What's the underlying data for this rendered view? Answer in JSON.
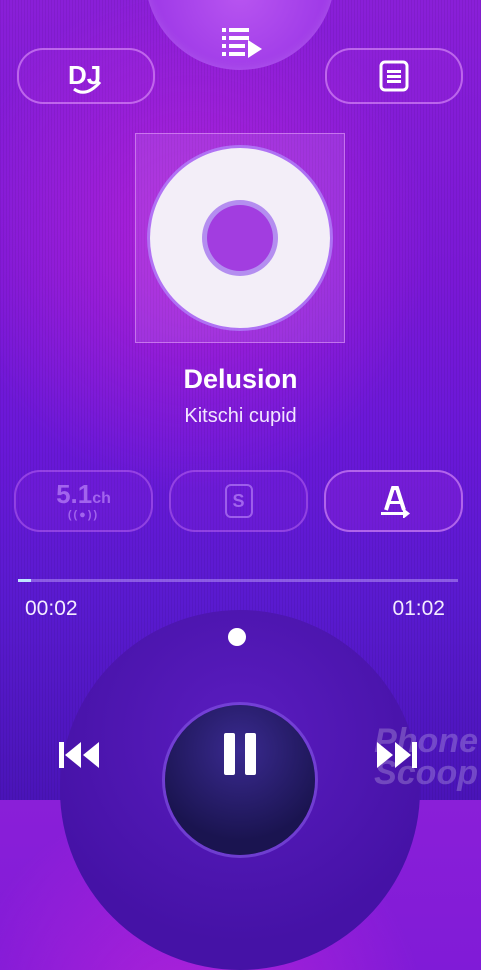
{
  "track": {
    "title": "Delusion",
    "artist": "Kitschi cupid"
  },
  "top": {
    "playlist_icon": "playlist-icon",
    "dj_icon": "dj-icon",
    "dj_label": "DJ",
    "list_icon": "list-icon"
  },
  "effects": {
    "surround_label": "5.1",
    "surround_unit": "ch",
    "surround_dots": "((●))",
    "s_label": "S",
    "text_icon": "text-style-icon"
  },
  "progress": {
    "elapsed": "00:02",
    "total": "01:02",
    "fraction": 0.03
  },
  "controls": {
    "prev_icon": "skip-previous-icon",
    "pause_icon": "pause-icon",
    "next_icon": "skip-next-icon"
  },
  "watermark": "Phone Scoop",
  "colors": {
    "accent": "#bfe6ff",
    "background": "#6a18d8"
  }
}
